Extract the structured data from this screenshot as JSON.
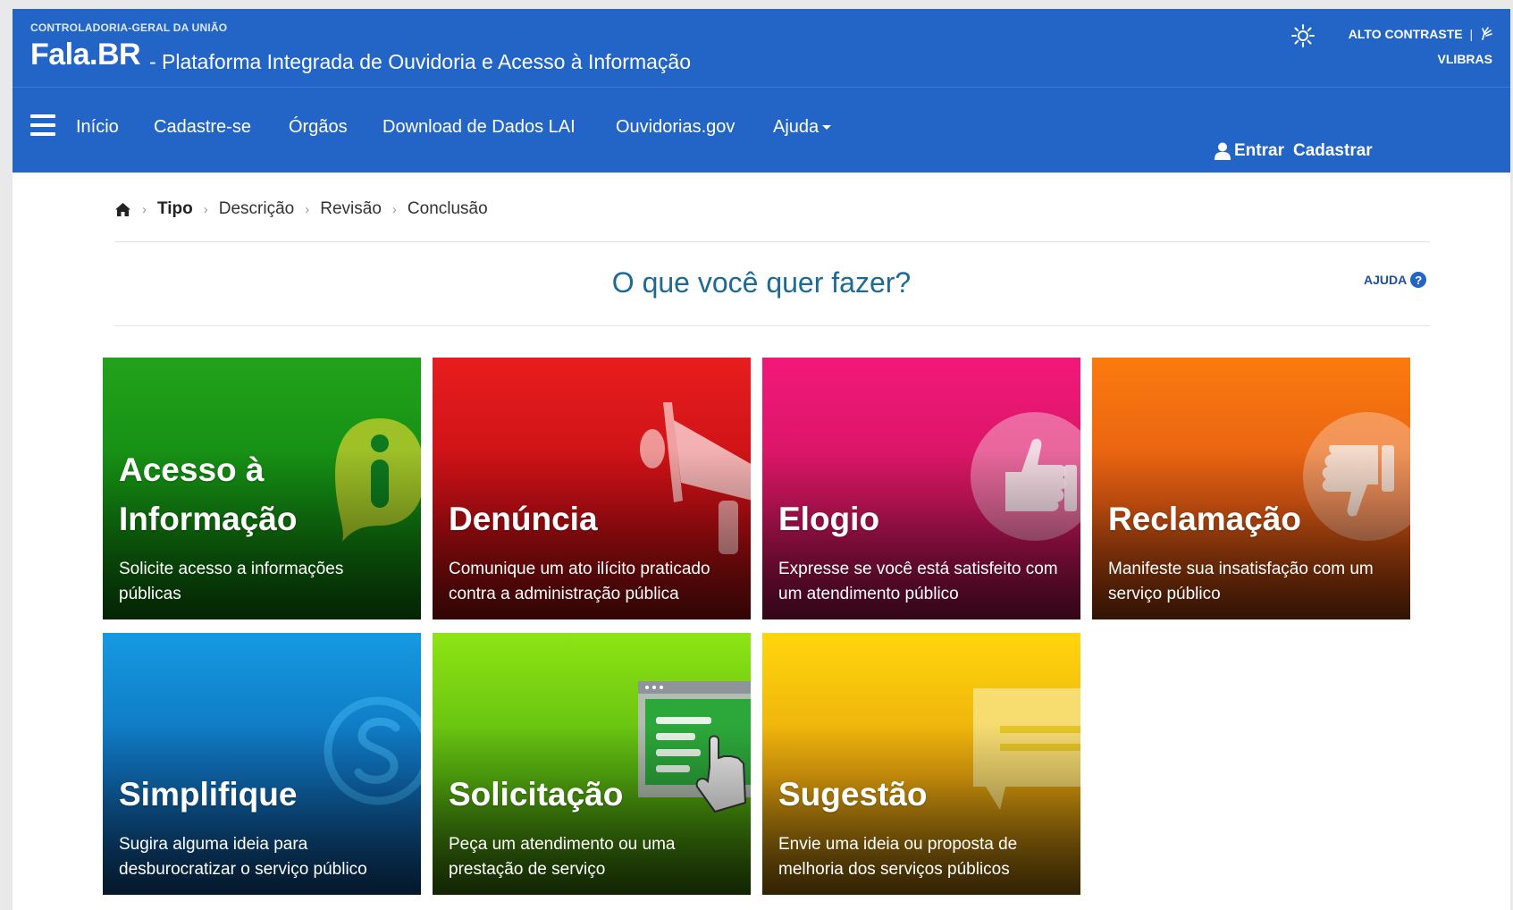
{
  "header": {
    "org": "CONTROLADORIA-GERAL DA UNIÃO",
    "brand": "Fala.BR",
    "subtitle": "- Plataforma Integrada de Ouvidoria e Acesso à Informação",
    "contrast_label": "ALTO CONTRASTE",
    "vlibras_label": "VLIBRAS",
    "icons": [
      "sun-icon",
      "sign-language-icon"
    ]
  },
  "nav": {
    "items": [
      "Início",
      "Cadastre-se",
      "Órgãos",
      "Download de Dados LAI",
      "Ouvidorias.gov",
      "Ajuda"
    ],
    "login_label": "Entrar",
    "register_label": "Cadastrar"
  },
  "breadcrumb": {
    "steps": [
      "Tipo",
      "Descrição",
      "Revisão",
      "Conclusão"
    ],
    "active": "Tipo"
  },
  "main": {
    "question": "O que você quer fazer?",
    "help_label": "AJUDA",
    "cards": [
      {
        "title_line1": "Acesso à",
        "title_line2": "Informação",
        "description": "Solicite acesso a informações públicas",
        "color": "#139113",
        "icon": "info-bubble-icon"
      },
      {
        "title": "Denúncia",
        "description": "Comunique um ato ilícito praticado contra a administração pública",
        "color": "#d4141a",
        "icon": "megaphone-icon"
      },
      {
        "title": "Elogio",
        "description": "Expresse se você está satisfeito com um atendimento público",
        "color": "#e3186d",
        "icon": "thumbs-up-icon"
      },
      {
        "title": "Reclamação",
        "description": "Manifeste sua insatisfação com um serviço público",
        "color": "#f06a10",
        "icon": "thumbs-down-icon"
      },
      {
        "title": "Simplifique",
        "description": "Sugira alguma ideia para desburocratizar o serviço público",
        "color": "#1180cc",
        "icon": "simplifique-s-icon"
      },
      {
        "title": "Solicitação",
        "description": "Peça um atendimento ou uma prestação de serviço",
        "color": "#6cc712",
        "icon": "form-click-icon"
      },
      {
        "title": "Sugestão",
        "description": "Envie uma ideia ou proposta de melhoria dos serviços públicos",
        "color": "#f4bf0b",
        "icon": "speech-bubble-icon"
      }
    ]
  },
  "colors": {
    "header_bg": "#2365c7",
    "question_text": "#1d6a96"
  }
}
